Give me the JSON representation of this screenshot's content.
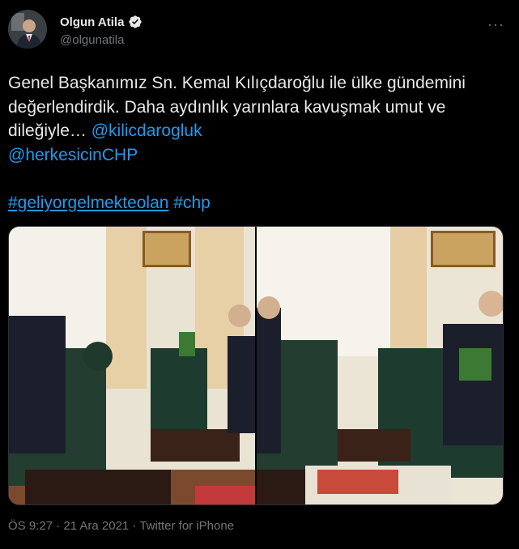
{
  "author": {
    "display_name": "Olgun Atila",
    "handle": "@olgunatila",
    "verified": true,
    "avatar_icon": "profile-photo"
  },
  "menu": {
    "more_icon": "ellipsis-icon",
    "more_label": "···"
  },
  "tweet": {
    "text_part1": "Genel Başkanımız Sn. Kemal Kılıçdaroğlu ile ülke gündemini değerlendirdik. Daha aydınlık yarınlara kavuşmak umut ve dileğiyle… ",
    "mention1": "@kilicdarogluk",
    "mention2": "@herkesicinCHP",
    "hashtag1": "#geliyorgelmekteolan",
    "hashtag2": "#chp"
  },
  "media": {
    "count": 2
  },
  "meta": {
    "text": "ÖS 9:27 · 21 Ara 2021 · Twitter for iPhone"
  },
  "colors": {
    "background": "#000000",
    "text": "#e7e9ea",
    "muted": "#71767b",
    "link": "#1d9bf0",
    "verified": "#e7e9ea"
  }
}
